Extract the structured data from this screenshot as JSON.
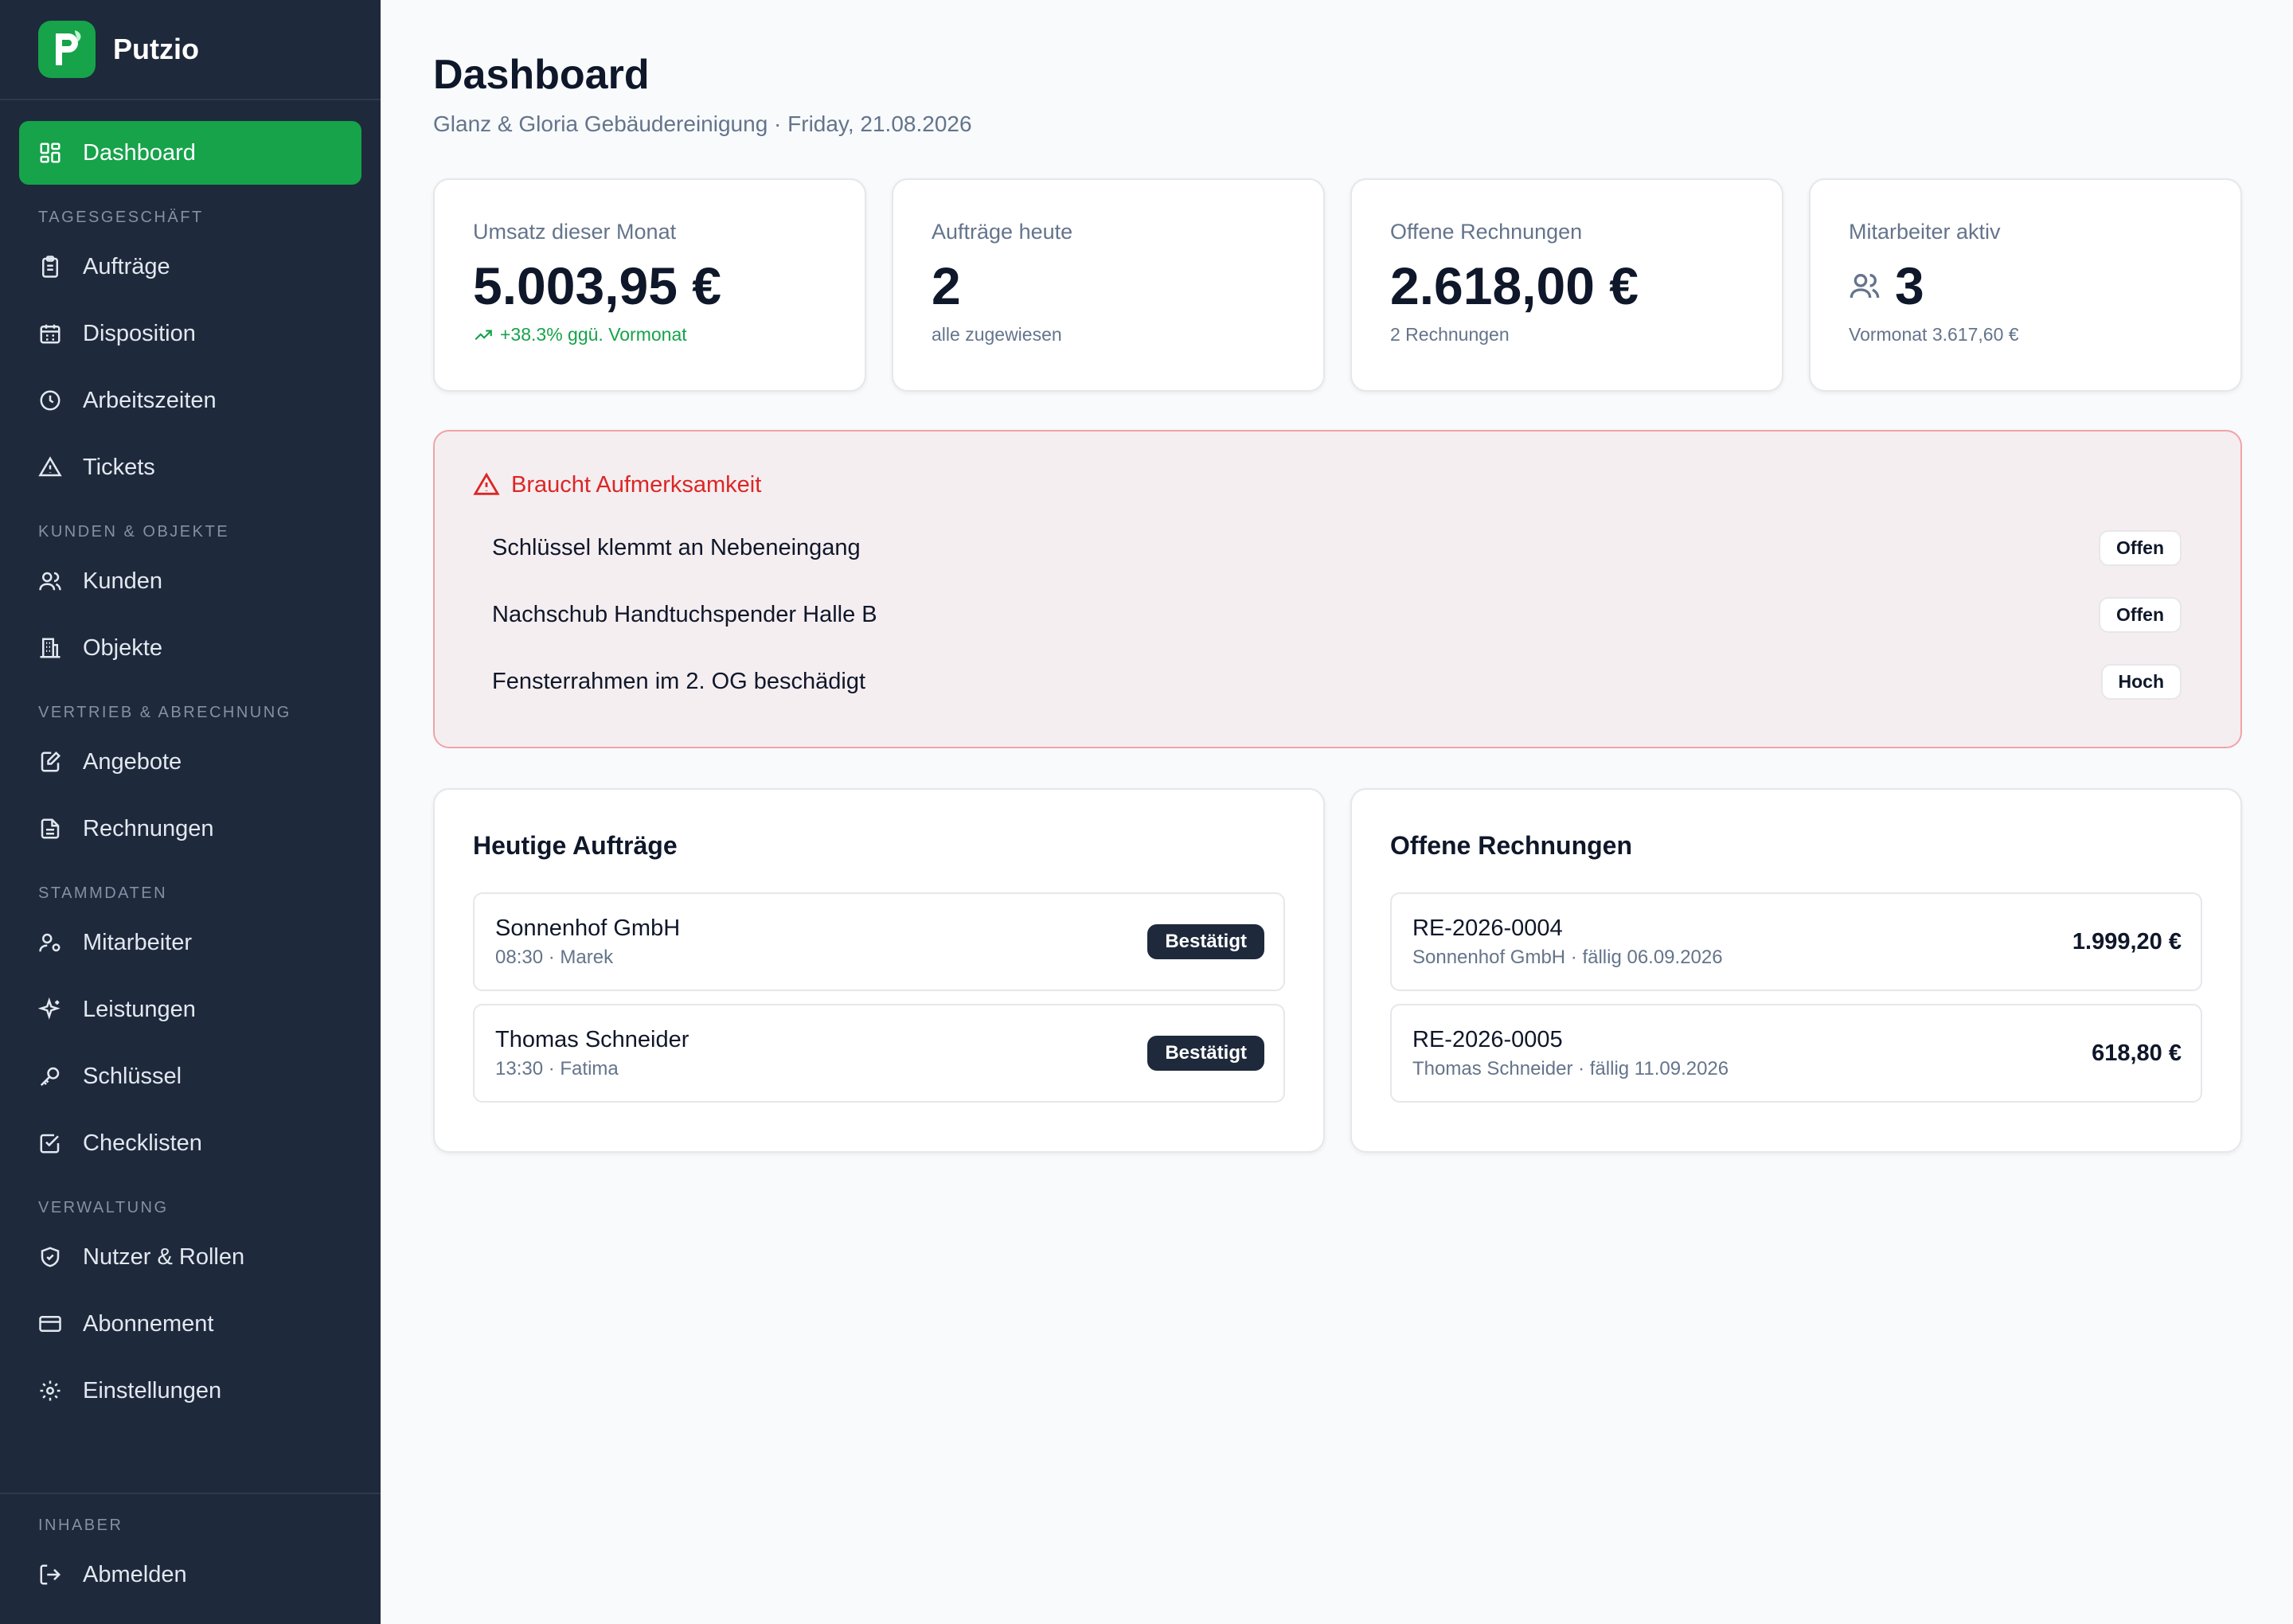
{
  "brand": {
    "name": "Putzio"
  },
  "sidebar": {
    "active": {
      "label": "Dashboard"
    },
    "sections": [
      {
        "title": "Tagesgeschäft",
        "items": [
          "Aufträge",
          "Disposition",
          "Arbeitszeiten",
          "Tickets"
        ]
      },
      {
        "title": "Kunden & Objekte",
        "items": [
          "Kunden",
          "Objekte"
        ]
      },
      {
        "title": "Vertrieb & Abrechnung",
        "items": [
          "Angebote",
          "Rechnungen"
        ]
      },
      {
        "title": "Stammdaten",
        "items": [
          "Mitarbeiter",
          "Leistungen",
          "Schlüssel",
          "Checklisten"
        ]
      },
      {
        "title": "Verwaltung",
        "items": [
          "Nutzer & Rollen",
          "Abonnement",
          "Einstellungen"
        ]
      }
    ],
    "footer": {
      "role": "Inhaber",
      "logout": "Abmelden"
    }
  },
  "header": {
    "title": "Dashboard",
    "subtitle": "Glanz & Gloria Gebäudereinigung · Friday, 21.08.2026"
  },
  "kpis": [
    {
      "label": "Umsatz dieser Monat",
      "value": "5.003,95 €",
      "sub": "+38.3% ggü. Vormonat"
    },
    {
      "label": "Aufträge heute",
      "value": "2",
      "sub": "alle zugewiesen"
    },
    {
      "label": "Offene Rechnungen",
      "value": "2.618,00 €",
      "sub": "2 Rechnungen"
    },
    {
      "label": "Mitarbeiter aktiv",
      "value": "3",
      "sub": "Vormonat 3.617,60 €"
    }
  ],
  "attention": {
    "title": "Braucht Aufmerksamkeit",
    "items": [
      {
        "text": "Schlüssel klemmt an Nebeneingang",
        "badge": "Offen"
      },
      {
        "text": "Nachschub Handtuchspender Halle B",
        "badge": "Offen"
      },
      {
        "text": "Fensterrahmen im 2. OG beschädigt",
        "badge": "Hoch"
      }
    ]
  },
  "today_orders": {
    "title": "Heutige Aufträge",
    "rows": [
      {
        "customer": "Sonnenhof GmbH",
        "meta": "08:30 · Marek",
        "status": "Bestätigt"
      },
      {
        "customer": "Thomas Schneider",
        "meta": "13:30 · Fatima",
        "status": "Bestätigt"
      }
    ]
  },
  "open_invoices": {
    "title": "Offene Rechnungen",
    "rows": [
      {
        "number": "RE-2026-0004",
        "meta": "Sonnenhof GmbH · fällig 06.09.2026",
        "amount": "1.999,20 €"
      },
      {
        "number": "RE-2026-0005",
        "meta": "Thomas Schneider · fällig 11.09.2026",
        "amount": "618,80 €"
      }
    ]
  },
  "colors": {
    "sidebar": "#1e293b",
    "accent": "#16a34a",
    "danger": "#dc2626"
  }
}
